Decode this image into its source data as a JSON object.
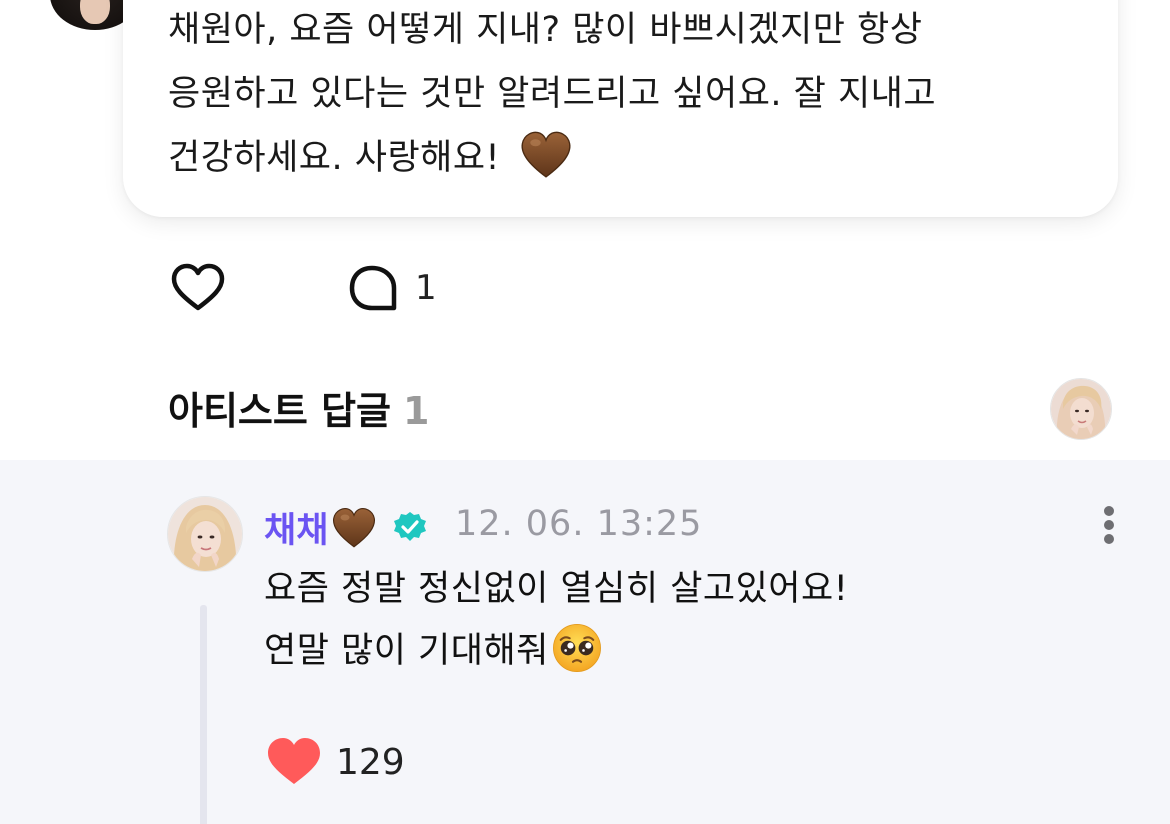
{
  "post": {
    "body_line1": "채원아, 요즘 어떻게 지내? 많이 바쁘시겠지만 항상",
    "body_line2": "응원하고 있다는 것만 알려드리고 싶어요. 잘 지내고",
    "body_line3": "건강하세요. 사랑해요! ",
    "body_emoji": "brown-heart",
    "comment_count": "1"
  },
  "artist_replies": {
    "title": "아티스트 답글",
    "count": "1"
  },
  "reply": {
    "author": "채채",
    "author_emoji": "brown-heart",
    "verified_icon": "verified-badge-icon",
    "timestamp": "12. 06. 13:25",
    "line1": "요즘 정말 정신없이 열심히 살고있어요!",
    "line2": "연말 많이 기대해줘",
    "line2_emoji": "pleading-face",
    "like_count": "129"
  },
  "colors": {
    "author_name": "#6b54f2",
    "verified_badge": "#1fc7c0",
    "liked_heart": "#ff5a5a",
    "reply_background": "#f5f6fa",
    "brown_heart": "#7a4a28"
  }
}
